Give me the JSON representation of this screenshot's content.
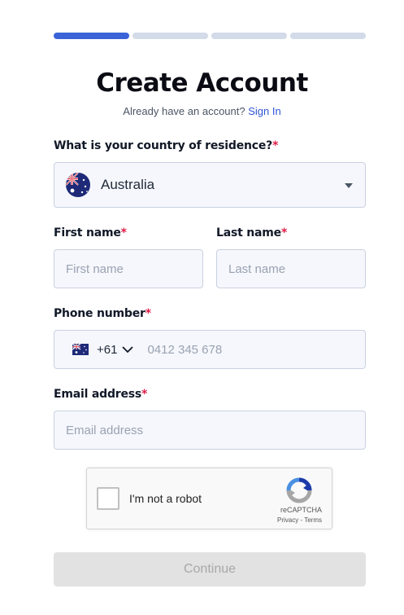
{
  "progress": {
    "total_steps": 4,
    "current_step": 1
  },
  "header": {
    "title": "Create Account",
    "subtitle_prefix": "Already have an account?",
    "sign_in_link": "Sign In"
  },
  "form": {
    "country": {
      "label": "What is your country of residence?",
      "required_mark": "*",
      "value": "Australia",
      "flag_icon": "australia-flag-icon"
    },
    "first_name": {
      "label": "First name",
      "required_mark": "*",
      "placeholder": "First name"
    },
    "last_name": {
      "label": "Last name",
      "required_mark": "*",
      "placeholder": "Last name"
    },
    "phone": {
      "label": "Phone number",
      "required_mark": "*",
      "dial_code": "+61",
      "placeholder": "0412 345 678",
      "flag_icon": "australia-flag-icon"
    },
    "email": {
      "label": "Email address",
      "required_mark": "*",
      "placeholder": "Email address"
    }
  },
  "captcha": {
    "label": "I'm not a robot",
    "brand": "reCAPTCHA",
    "privacy": "Privacy",
    "separator": " - ",
    "terms": "Terms"
  },
  "actions": {
    "continue_label": "Continue"
  },
  "colors": {
    "accent": "#3b63d8",
    "link": "#2f55d4",
    "required": "#e11d48",
    "field_bg": "#f5f7fc",
    "disabled_button": "#e2e2e2"
  }
}
